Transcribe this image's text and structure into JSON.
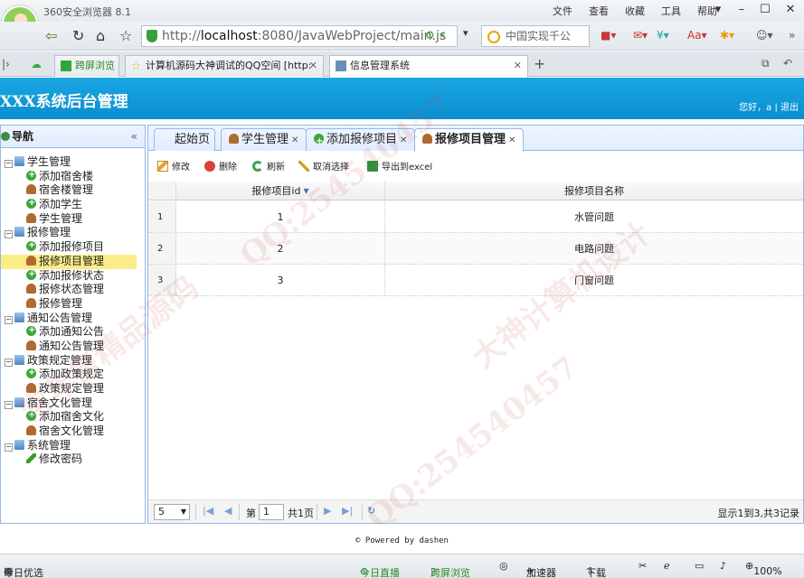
{
  "browser": {
    "title": "360安全浏览器 8.1",
    "menu": [
      "文件",
      "查看",
      "收藏",
      "工具",
      "帮助"
    ],
    "url_host": "localhost",
    "url_rest": ":8080/JavaWebProject/main.js",
    "url_scheme": "http://",
    "search_placeholder": "中国实现千公",
    "tabs": [
      {
        "label": "跨屏浏览"
      },
      {
        "label": "计算机源码大神调试的QQ空间 [http:"
      },
      {
        "label": "信息管理系统"
      }
    ],
    "zoom": "100%",
    "status_items": [
      "今日优选",
      "今日直播",
      "跨屏浏览",
      "加速器",
      "下载"
    ]
  },
  "app": {
    "system_title": "XXX系统后台管理",
    "greeting": "您好，a | 退出"
  },
  "nav": {
    "title": "导航",
    "groups": [
      {
        "label": "学生管理",
        "items": [
          "添加宿舍楼",
          "宿舍楼管理",
          "添加学生",
          "学生管理"
        ]
      },
      {
        "label": "报修管理",
        "items": [
          "添加报修项目",
          "报修项目管理",
          "添加报修状态",
          "报修状态管理",
          "报修管理"
        ]
      },
      {
        "label": "通知公告管理",
        "items": [
          "添加通知公告",
          "通知公告管理"
        ]
      },
      {
        "label": "政策规定管理",
        "items": [
          "添加政策规定",
          "政策规定管理"
        ]
      },
      {
        "label": "宿舍文化管理",
        "items": [
          "添加宿舍文化",
          "宿舍文化管理"
        ]
      },
      {
        "label": "系统管理",
        "items": [
          "修改密码"
        ]
      }
    ]
  },
  "tabs": [
    {
      "label": "起始页"
    },
    {
      "label": "学生管理"
    },
    {
      "label": "添加报修项目"
    },
    {
      "label": "报修项目管理"
    }
  ],
  "toolbar": {
    "edit": "修改",
    "delete": "删除",
    "refresh": "刷新",
    "cancel_select": "取消选择",
    "export": "导出到excel"
  },
  "grid": {
    "headers": [
      "报修项目id",
      "报修项目名称"
    ],
    "rows": [
      {
        "rn": "1",
        "id": "1",
        "name": "水管问题"
      },
      {
        "rn": "2",
        "id": "2",
        "name": "电路问题"
      },
      {
        "rn": "3",
        "id": "3",
        "name": "门窗问题"
      }
    ]
  },
  "pager": {
    "page_size": "5",
    "page_label": "第",
    "page_value": "1",
    "total_pages": "共1页",
    "summary": "显示1到3,共3记录"
  },
  "footer": "© Powered by dashen",
  "watermark": [
    "QQ:254540457",
    "大神计算机设计",
    "常年售精品源码"
  ]
}
